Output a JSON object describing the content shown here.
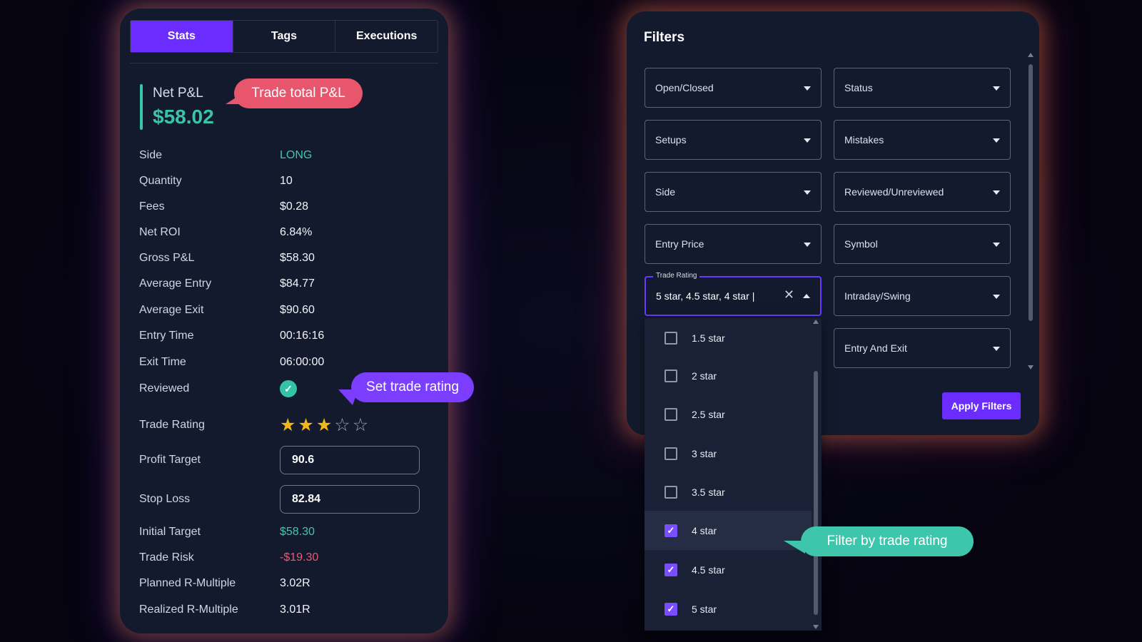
{
  "tabs": {
    "stats": "Stats",
    "tags": "Tags",
    "executions": "Executions"
  },
  "net_pnl": {
    "label": "Net P&L",
    "value": "$58.02"
  },
  "callouts": {
    "pnl": "Trade total P&L",
    "rating": "Set trade rating",
    "filter": "Filter by trade rating"
  },
  "stats": {
    "side": {
      "label": "Side",
      "value": "LONG"
    },
    "quantity": {
      "label": "Quantity",
      "value": "10"
    },
    "fees": {
      "label": "Fees",
      "value": "$0.28"
    },
    "net_roi": {
      "label": "Net ROI",
      "value": "6.84%"
    },
    "gross_pnl": {
      "label": "Gross P&L",
      "value": "$58.30"
    },
    "avg_entry": {
      "label": "Average Entry",
      "value": "$84.77"
    },
    "avg_exit": {
      "label": "Average Exit",
      "value": "$90.60"
    },
    "entry_time": {
      "label": "Entry Time",
      "value": "00:16:16"
    },
    "exit_time": {
      "label": "Exit Time",
      "value": "06:00:00"
    },
    "reviewed": {
      "label": "Reviewed",
      "checked": true
    },
    "trade_rating": {
      "label": "Trade Rating",
      "stars": 3,
      "max": 5
    },
    "profit_target": {
      "label": "Profit Target",
      "value": "90.6"
    },
    "stop_loss": {
      "label": "Stop Loss",
      "value": "82.84"
    },
    "initial_target": {
      "label": "Initial Target",
      "value": "$58.30"
    },
    "trade_risk": {
      "label": "Trade Risk",
      "value": "-$19.30"
    },
    "planned_r": {
      "label": "Planned R-Multiple",
      "value": "3.02R"
    },
    "realized_r": {
      "label": "Realized R-Multiple",
      "value": "3.01R"
    }
  },
  "filters": {
    "title": "Filters",
    "open_closed": "Open/Closed",
    "status": "Status",
    "setups": "Setups",
    "mistakes": "Mistakes",
    "side": "Side",
    "reviewed": "Reviewed/Unreviewed",
    "entry_price": "Entry Price",
    "symbol": "Symbol",
    "trade_rating_label": "Trade Rating",
    "trade_rating_value": "5 star, 4.5 star, 4 star",
    "intraday": "Intraday/Swing",
    "entry_exit": "Entry And Exit",
    "apply": "Apply Filters"
  },
  "rating_options": [
    {
      "label": "1.5 star",
      "checked": false
    },
    {
      "label": "2 star",
      "checked": false
    },
    {
      "label": "2.5 star",
      "checked": false
    },
    {
      "label": "3 star",
      "checked": false
    },
    {
      "label": "3.5 star",
      "checked": false
    },
    {
      "label": "4 star",
      "checked": true
    },
    {
      "label": "4.5 star",
      "checked": true
    },
    {
      "label": "5 star",
      "checked": true
    }
  ],
  "colors": {
    "accent": "#6a2cff",
    "profit": "#39c6a6",
    "loss": "#f0566e",
    "star": "#f2b51a"
  }
}
